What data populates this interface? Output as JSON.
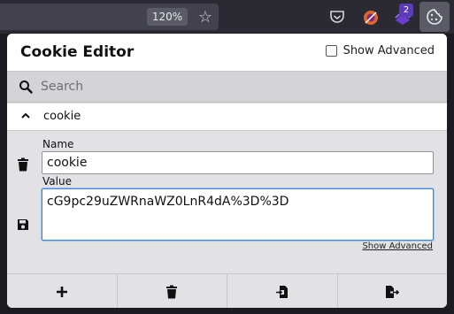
{
  "browser": {
    "zoom_level": "120%",
    "icons": {
      "star": "star-icon",
      "pocket": "pocket-icon",
      "extension_one": "extension-icon",
      "extension_two": "extension-icon",
      "cookie_editor": "cookie-icon"
    },
    "extension_badge_count": "2"
  },
  "popup": {
    "title": "Cookie Editor",
    "show_advanced_label": "Show Advanced",
    "search": {
      "placeholder": "Search",
      "value": ""
    },
    "cookie": {
      "name": "cookie",
      "name_label": "Name",
      "name_value": "cookie",
      "value_label": "Value",
      "value_value": "cG9pc29uZWRnaWZ0LnR4dA%3D%3D",
      "show_advanced_link": "Show Advanced"
    },
    "footer_actions": [
      "add",
      "delete-all",
      "import",
      "export"
    ]
  },
  "colors": {
    "toolbar": "#2b2a33",
    "panel": "#e2e2e4",
    "focus_border": "#3f88d4",
    "badge": "#5b3bb8"
  }
}
